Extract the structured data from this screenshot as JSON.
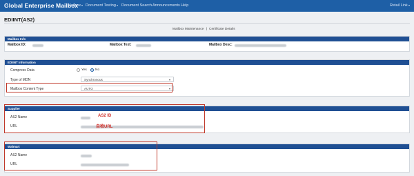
{
  "app": {
    "brand": "Global Enterprise Mailbox"
  },
  "nav": {
    "items": [
      "Mailbox",
      "Document Testing",
      "Document Search",
      "Announcements",
      "Help"
    ],
    "user_menu": "Retail Link"
  },
  "page": {
    "title": "EDIINT(AS2)",
    "breadcrumb_left": "Mailbox Maintenance",
    "breadcrumb_sep": "|",
    "breadcrumb_right": "Certificate Details"
  },
  "mailbox_info": {
    "heading": "Mailbox Info",
    "id_label": "Mailbox ID:",
    "text_label": "Mailbox Text:",
    "desc_label": "Mailbox Desc:"
  },
  "ediint_info": {
    "heading": "EDIINT Information",
    "compress_label": "Compress Data",
    "compress_options": [
      "Yes",
      "No"
    ],
    "compress_selected": "No",
    "mdn_label": "Type of MDN",
    "mdn_value": "Synchronous",
    "content_type_label": "Mailbox Content Type",
    "content_type_value": "AUTO"
  },
  "supplier": {
    "heading": "Supplier",
    "as2_label": "AS2 Name",
    "url_label": "URL",
    "as2_annotation": "AS2 ID",
    "url_annotation": "自检URL"
  },
  "walmart": {
    "heading": "Walmart",
    "as2_label": "AS2 Name",
    "url_label": "URL"
  },
  "colors": {
    "navbar": "#1e5fa6",
    "panel_header": "#1f4f93",
    "annotation": "#c0392b"
  }
}
